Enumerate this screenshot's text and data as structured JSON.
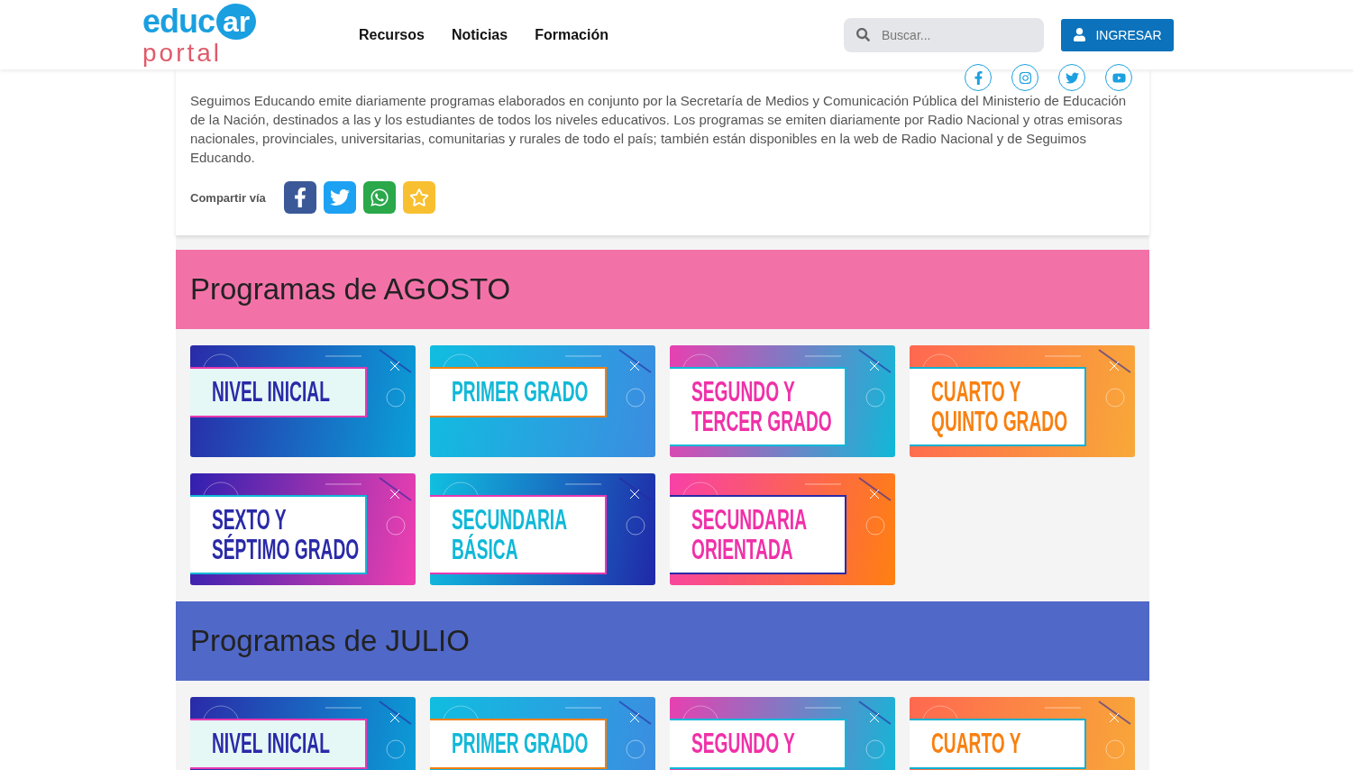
{
  "header": {
    "logo_top": "educ",
    "logo_badge": "ar",
    "logo_bottom": "portal",
    "nav": [
      "Recursos",
      "Noticias",
      "Formación"
    ],
    "search": {
      "placeholder": "Buscar..."
    },
    "login_button": "INGRESAR"
  },
  "intro": {
    "text": "Seguimos Educando emite diariamente programas elaborados en conjunto por la Secretaría de Medios y Comunicación Pública del Ministerio de Educación de la Nación, destinados a las y los estudiantes de todos los niveles educativos. Los programas se emiten diariamente por Radio Nacional y otras emisoras nacionales, provinciales, universitarias, comunitarias y rurales de todo el país; también están disponibles en la web de Radio Nacional y de Seguimos Educando.",
    "share_label": "Compartir vía",
    "share": [
      {
        "kind": "facebook"
      },
      {
        "kind": "twitter"
      },
      {
        "kind": "whatsapp"
      },
      {
        "kind": "favorite"
      }
    ]
  },
  "social": [
    {
      "kind": "facebook"
    },
    {
      "kind": "instagram"
    },
    {
      "kind": "twitter"
    },
    {
      "kind": "youtube"
    }
  ],
  "sections": [
    {
      "title": "Programas de AGOSTO",
      "color": "#f272a8",
      "cards": [
        {
          "kind": "blue",
          "lines": [
            "NIVEL INICIAL"
          ]
        },
        {
          "kind": "cyan",
          "lines": [
            "PRIMER GRADO"
          ]
        },
        {
          "kind": "pinkcyan",
          "lines": [
            "SEGUNDO Y",
            "TERCER GRADO"
          ]
        },
        {
          "kind": "orange",
          "lines": [
            "CUARTO Y",
            "QUINTO GRADO"
          ]
        },
        {
          "kind": "purple",
          "lines": [
            "SEXTO Y",
            "SÉPTIMO GRADO"
          ]
        },
        {
          "kind": "teal",
          "lines": [
            "SECUNDARIA",
            "BÁSICA"
          ]
        },
        {
          "kind": "sunset",
          "lines": [
            "SECUNDARIA",
            "ORIENTADA"
          ]
        }
      ]
    },
    {
      "title": "Programas de JULIO",
      "color": "#5068c8",
      "cards": [
        {
          "kind": "blue",
          "lines": [
            "NIVEL INICIAL"
          ]
        },
        {
          "kind": "cyan",
          "lines": [
            "PRIMER GRADO"
          ]
        },
        {
          "kind": "pinkcyan",
          "lines": [
            "SEGUNDO Y"
          ]
        },
        {
          "kind": "orange",
          "lines": [
            "CUARTO Y"
          ]
        }
      ]
    }
  ]
}
